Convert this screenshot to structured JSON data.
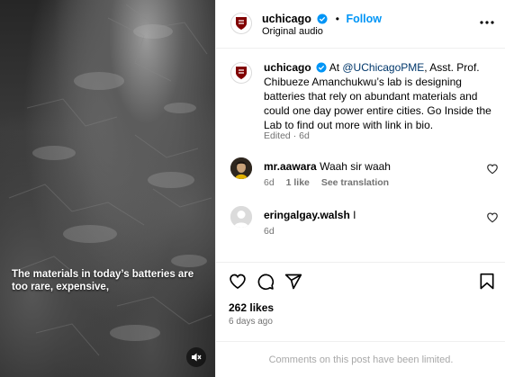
{
  "media": {
    "caption": "The materials in today’s batteries are too rare, expensive,",
    "mute_icon": "speaker-muted-icon"
  },
  "header": {
    "username": "uchicago",
    "verified_icon": "verified-badge-icon",
    "separator": "•",
    "follow_label": "Follow",
    "audio_label": "Original audio",
    "more_icon": "more-options-icon"
  },
  "caption_post": {
    "username": "uchicago",
    "prefix": "At ",
    "mention": "@UChicagoPME",
    "body": ", Asst. Prof. Chibueze Amanchukwu’s lab is designing batteries that rely on abundant materials and could one day power entire cities. Go Inside the Lab to find out more with link in bio.",
    "meta": "Edited · 6d"
  },
  "comments": [
    {
      "username": "mr.aawara",
      "text": "Waah sir waah",
      "age": "6d",
      "likes": "1 like",
      "translate": "See translation"
    },
    {
      "username": "eringalgay.walsh",
      "text": "I",
      "age": "6d"
    }
  ],
  "actions": {
    "like_icon": "heart-icon",
    "comment_icon": "comment-icon",
    "share_icon": "share-icon",
    "save_icon": "bookmark-icon"
  },
  "likes": "262 likes",
  "posted": "6 days ago",
  "limited_notice": "Comments on this post have been limited.",
  "colors": {
    "link": "#0095f6",
    "mention": "#00376b",
    "muted": "#737373",
    "brand_maroon": "#800000"
  }
}
